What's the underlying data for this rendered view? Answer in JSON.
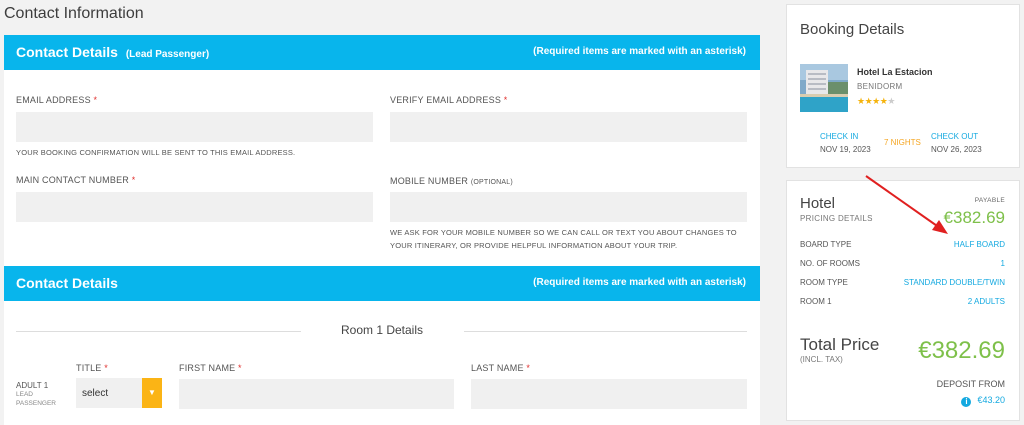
{
  "page": {
    "title": "Contact Information"
  },
  "section1": {
    "title": "Contact Details",
    "subtitle": "(Lead Passenger)",
    "required_note": "(Required items are marked with an asterisk)",
    "email_label": "EMAIL ADDRESS",
    "verify_email_label": "VERIFY EMAIL ADDRESS",
    "email_note": "YOUR BOOKING CONFIRMATION WILL BE SENT TO THIS EMAIL ADDRESS.",
    "main_contact_label": "MAIN CONTACT NUMBER",
    "mobile_label": "MOBILE NUMBER",
    "mobile_optional": "(OPTIONAL)",
    "mobile_note_line1": "WE ASK FOR YOUR MOBILE NUMBER SO WE CAN CALL OR TEXT YOU ABOUT CHANGES TO",
    "mobile_note_line2": "YOUR ITINERARY, OR PROVIDE HELPFUL INFORMATION ABOUT YOUR TRIP.",
    "asterisk": "*"
  },
  "section2": {
    "title": "Contact Details",
    "required_note": "(Required items are marked with an asterisk)",
    "room_title": "Room 1 Details",
    "adult_label": "ADULT 1",
    "lead_line1": "LEAD",
    "lead_line2": "PASSENGER",
    "title_label": "TITLE",
    "first_name_label": "FIRST NAME",
    "last_name_label": "LAST NAME",
    "title_select_value": "select"
  },
  "booking": {
    "title": "Booking Details",
    "hotel_name": "Hotel La Estacion",
    "location": "BENIDORM",
    "rating": 4,
    "rating_max": 5,
    "check_in_label": "CHECK IN",
    "check_in_date": "NOV 19, 2023",
    "nights": "7 NIGHTS",
    "check_out_label": "CHECK OUT",
    "check_out_date": "NOV 26, 2023"
  },
  "pricing": {
    "title": "Hotel",
    "subtitle": "PRICING DETAILS",
    "payable_label": "PAYABLE",
    "hotel_price": "€382.69",
    "rows": [
      {
        "label": "BOARD TYPE",
        "value": "HALF BOARD"
      },
      {
        "label": "NO. OF ROOMS",
        "value": "1"
      },
      {
        "label": "ROOM TYPE",
        "value": "STANDARD DOUBLE/TWIN"
      },
      {
        "label": "ROOM 1",
        "value": "2 ADULTS"
      }
    ],
    "total_label": "Total Price",
    "total_sub": "(INCL. TAX)",
    "total_price": "€382.69",
    "deposit_label": "DEPOSIT FROM",
    "deposit_value": "€43.20"
  },
  "colors": {
    "accent_blue": "#08b5ec",
    "price_green": "#7ec04a",
    "select_button": "#fbb415",
    "annotation_arrow": "#e02020"
  }
}
